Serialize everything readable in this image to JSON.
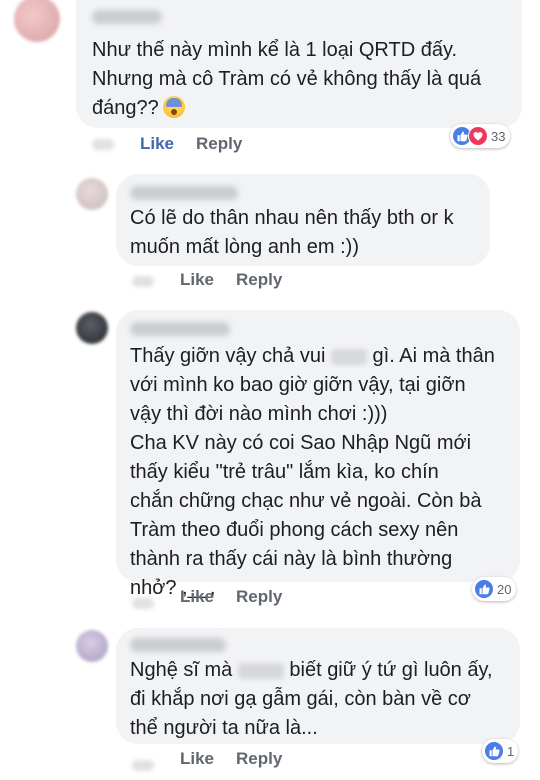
{
  "comments": [
    {
      "lines": [
        "Như thế này mình kể là 1 loại QRTD đấy.",
        "Nhưng mà cô Tràm có vẻ không thấy là quá",
        "đáng??"
      ],
      "emoji": "fearful-face-emoji",
      "like_label": "Like",
      "reply_label": "Reply",
      "liked": true,
      "reactions": [
        "like",
        "love"
      ],
      "reaction_count": "33"
    },
    {
      "lines": [
        "Có lẽ do thân nhau nên thấy bth or k",
        "muốn mất lòng anh em :))"
      ],
      "like_label": "Like",
      "reply_label": "Reply",
      "liked": false
    },
    {
      "segments": {
        "l1a": "Thấy giỡn vậy chả vui ",
        "l1b": " gì. Ai mà thân",
        "l2": "với mình ko bao giờ giỡn vậy, tại giỡn",
        "l3": "vậy thì đời nào mình chơi :)))",
        "l4": "Cha KV này có coi Sao Nhập Ngũ mới",
        "l5": "thấy kiểu \"trẻ trâu\" lắm kìa, ko chín",
        "l6": "chắn chững chạc như vẻ ngoài. Còn bà",
        "l7": "Tràm theo đuổi phong cách sexy nên",
        "l8": "thành ra thấy cái này là bình thường",
        "l9": "nhở?  ,__,"
      },
      "like_label": "Like",
      "reply_label": "Reply",
      "liked": false,
      "reactions": [
        "like"
      ],
      "reaction_count": "20"
    },
    {
      "segments": {
        "l1a": "Nghệ sĩ mà ",
        "l1b": " biết giữ ý tứ gì luôn ấy,",
        "l2": "đi khắp nơi gạ gẫm gái, còn bàn về cơ",
        "l3": "thể người ta nữa là..."
      },
      "like_label": "Like",
      "reply_label": "Reply",
      "liked": false,
      "reactions": [
        "like"
      ],
      "reaction_count": "1"
    }
  ],
  "colors": {
    "bubble": "#f2f3f5",
    "action_text": "#606770",
    "liked_text": "#4267b2",
    "like_reaction": "#4a7de6",
    "love_reaction": "#f0375b"
  }
}
